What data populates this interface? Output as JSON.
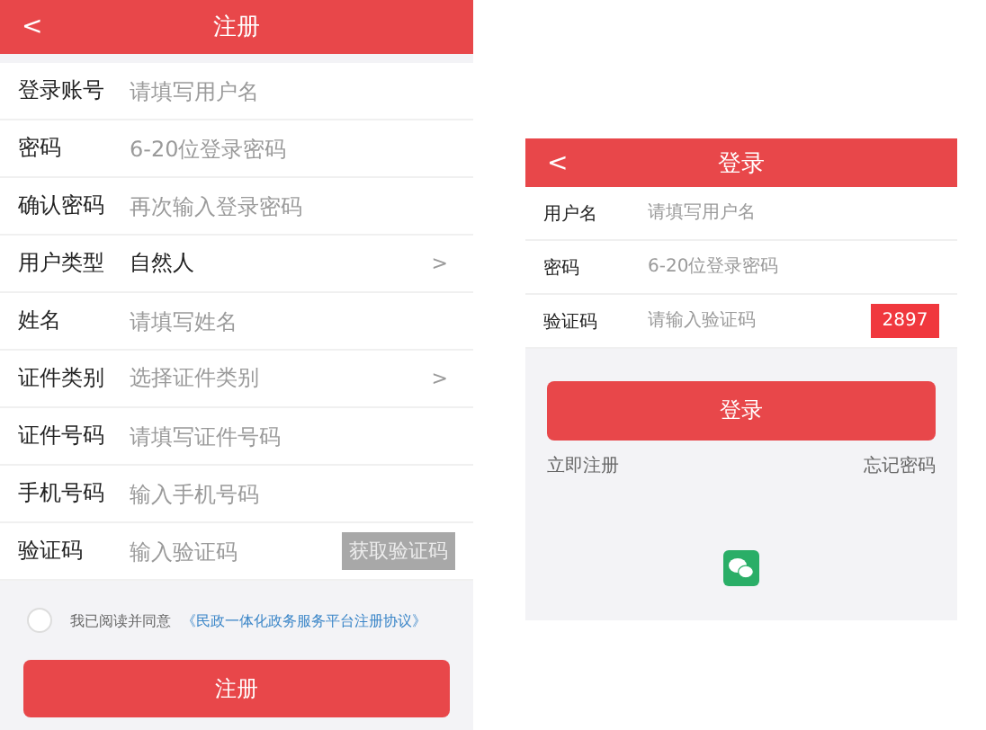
{
  "register": {
    "title": "注册",
    "back": "<",
    "fields": [
      {
        "kind": "input",
        "label": "登录账号",
        "placeholder": "请填写用户名"
      },
      {
        "kind": "input",
        "label": "密码",
        "placeholder": "6-20位登录密码"
      },
      {
        "kind": "input",
        "label": "确认密码",
        "placeholder": "再次输入登录密码"
      },
      {
        "kind": "select",
        "label": "用户类型",
        "value": "自然人",
        "chevron": ">"
      },
      {
        "kind": "input",
        "label": "姓名",
        "placeholder": "请填写姓名"
      },
      {
        "kind": "select",
        "label": "证件类别",
        "placeholder": "选择证件类别",
        "chevron": ">"
      },
      {
        "kind": "input",
        "label": "证件号码",
        "placeholder": "请填写证件号码"
      },
      {
        "kind": "input",
        "label": "手机号码",
        "placeholder": "输入手机号码"
      },
      {
        "kind": "code",
        "label": "验证码",
        "placeholder": "输入验证码",
        "button": "获取验证码",
        "disabled": true
      }
    ],
    "agreement": {
      "checked": false,
      "text": "我已阅读并同意",
      "link": "《民政一体化政务服务平台注册协议》"
    },
    "submit": "注册"
  },
  "login": {
    "title": "登录",
    "back": "<",
    "fields": [
      {
        "kind": "input",
        "label": "用户名",
        "placeholder": "请填写用户名"
      },
      {
        "kind": "input",
        "label": "密码",
        "placeholder": "6-20位登录密码"
      },
      {
        "kind": "code",
        "label": "验证码",
        "placeholder": "请输入验证码",
        "button": "2897",
        "disabled": false
      }
    ],
    "submit": "登录",
    "register_link": "立即注册",
    "forgot_link": "忘记密码"
  }
}
